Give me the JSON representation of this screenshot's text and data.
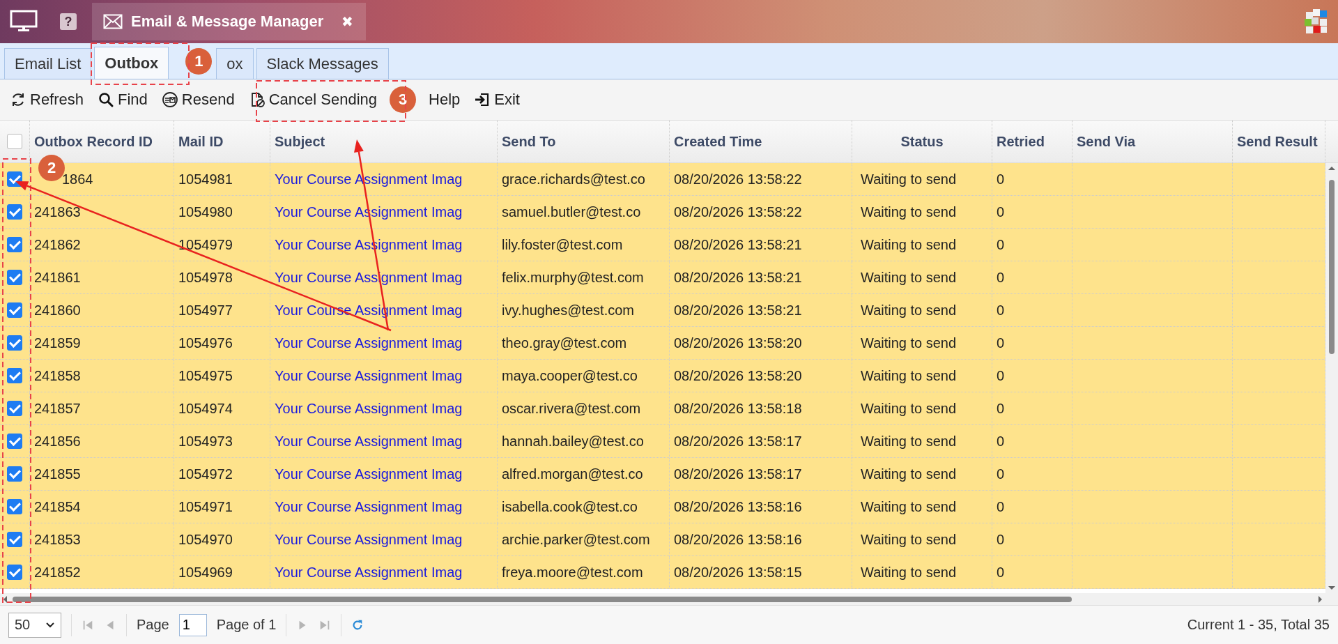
{
  "title_bar": {
    "help": "?",
    "tab": {
      "title": "Email & Message Manager",
      "close": "✖"
    }
  },
  "tabs": [
    {
      "label": "Email List",
      "selected": false
    },
    {
      "label": "Outbox",
      "selected": true
    },
    {
      "label": "ox",
      "selected": false
    },
    {
      "label": "Slack Messages",
      "selected": false
    }
  ],
  "toolbar": [
    "Refresh",
    "Find",
    "Resend",
    "Cancel Sending",
    "Help",
    "Exit"
  ],
  "table": {
    "select_all_checked": false,
    "columns": [
      "Outbox Record ID",
      "Mail ID",
      "Subject",
      "Send To",
      "Created Time",
      "Status",
      "Retried",
      "Send Via",
      "Send Result"
    ],
    "rows": [
      {
        "selected": true,
        "cells": [
          "1864",
          "1054981",
          "Your Course Assignment Imag",
          "grace.richards@test.co",
          "08/20/2026 13:58:22",
          "Waiting to send",
          "0"
        ]
      },
      {
        "selected": true,
        "cells": [
          "241863",
          "1054980",
          "Your Course Assignment Imag",
          "samuel.butler@test.co",
          "08/20/2026 13:58:22",
          "Waiting to send",
          "0"
        ]
      },
      {
        "selected": true,
        "cells": [
          "241862",
          "1054979",
          "Your Course Assignment Imag",
          "lily.foster@test.com",
          "08/20/2026 13:58:21",
          "Waiting to send",
          "0"
        ]
      },
      {
        "selected": true,
        "cells": [
          "241861",
          "1054978",
          "Your Course Assignment Imag",
          "felix.murphy@test.com",
          "08/20/2026 13:58:21",
          "Waiting to send",
          "0"
        ]
      },
      {
        "selected": true,
        "cells": [
          "241860",
          "1054977",
          "Your Course Assignment Imag",
          "ivy.hughes@test.com",
          "08/20/2026 13:58:21",
          "Waiting to send",
          "0"
        ]
      },
      {
        "selected": true,
        "cells": [
          "241859",
          "1054976",
          "Your Course Assignment Imag",
          "theo.gray@test.com",
          "08/20/2026 13:58:20",
          "Waiting to send",
          "0"
        ]
      },
      {
        "selected": true,
        "cells": [
          "241858",
          "1054975",
          "Your Course Assignment Imag",
          "maya.cooper@test.co",
          "08/20/2026 13:58:20",
          "Waiting to send",
          "0"
        ]
      },
      {
        "selected": true,
        "cells": [
          "241857",
          "1054974",
          "Your Course Assignment Imag",
          "oscar.rivera@test.com",
          "08/20/2026 13:58:18",
          "Waiting to send",
          "0"
        ]
      },
      {
        "selected": true,
        "cells": [
          "241856",
          "1054973",
          "Your Course Assignment Imag",
          "hannah.bailey@test.co",
          "08/20/2026 13:58:17",
          "Waiting to send",
          "0"
        ]
      },
      {
        "selected": true,
        "cells": [
          "241855",
          "1054972",
          "Your Course Assignment Imag",
          "alfred.morgan@test.co",
          "08/20/2026 13:58:17",
          "Waiting to send",
          "0"
        ]
      },
      {
        "selected": true,
        "cells": [
          "241854",
          "1054971",
          "Your Course Assignment Imag",
          "isabella.cook@test.co",
          "08/20/2026 13:58:16",
          "Waiting to send",
          "0"
        ]
      },
      {
        "selected": true,
        "cells": [
          "241853",
          "1054970",
          "Your Course Assignment Imag",
          "archie.parker@test.com",
          "08/20/2026 13:58:16",
          "Waiting to send",
          "0"
        ]
      },
      {
        "selected": true,
        "cells": [
          "241852",
          "1054969",
          "Your Course Assignment Imag",
          "freya.moore@test.com",
          "08/20/2026 13:58:15",
          "Waiting to send",
          "0"
        ]
      }
    ]
  },
  "pager": {
    "page_size": "50",
    "page_label": "Page",
    "page": "1",
    "page_of": "Page of 1",
    "summary": "Current 1 - 35, Total 35"
  },
  "annotations": [
    {
      "label": "1"
    },
    {
      "label": "2"
    },
    {
      "label": "3"
    }
  ]
}
